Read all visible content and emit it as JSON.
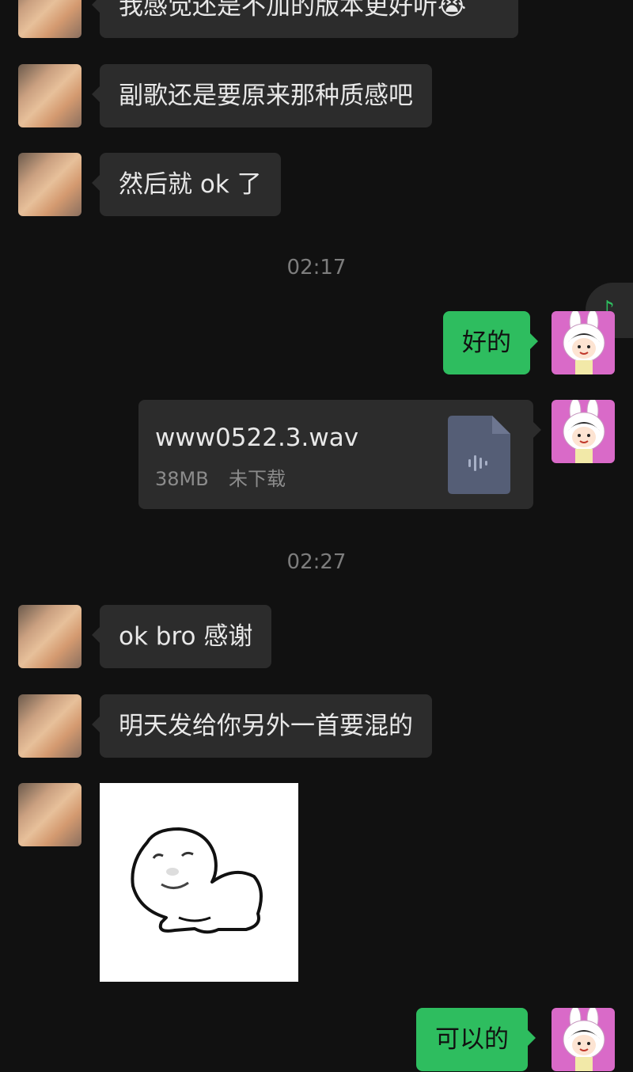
{
  "messages": [
    {
      "type": "text",
      "side": "left",
      "text": "我感觉还是不加的版本更好听😭"
    },
    {
      "type": "text",
      "side": "left",
      "text": "副歌还是要原来那种质感吧"
    },
    {
      "type": "text",
      "side": "left",
      "text": "然后就 ok 了"
    },
    {
      "type": "time",
      "text": "02:17"
    },
    {
      "type": "text",
      "side": "right",
      "text": "好的"
    },
    {
      "type": "file",
      "side": "right",
      "file_name": "www0522.3.wav",
      "file_size": "38MB",
      "file_status": "未下载"
    },
    {
      "type": "time",
      "text": "02:27"
    },
    {
      "type": "text",
      "side": "left",
      "text": "ok bro 感谢"
    },
    {
      "type": "text",
      "side": "left",
      "text": "明天发给你另外一首要混的"
    },
    {
      "type": "sticker",
      "side": "left",
      "sticker": "meme-blob-sticker"
    },
    {
      "type": "text",
      "side": "right",
      "text": "可以的"
    }
  ],
  "floating_music_icon": "♪",
  "colors": {
    "background": "#111111",
    "incoming_bubble": "#2c2c2c",
    "outgoing_bubble": "#2ebd5f",
    "timestamp": "#7d7d7d"
  }
}
